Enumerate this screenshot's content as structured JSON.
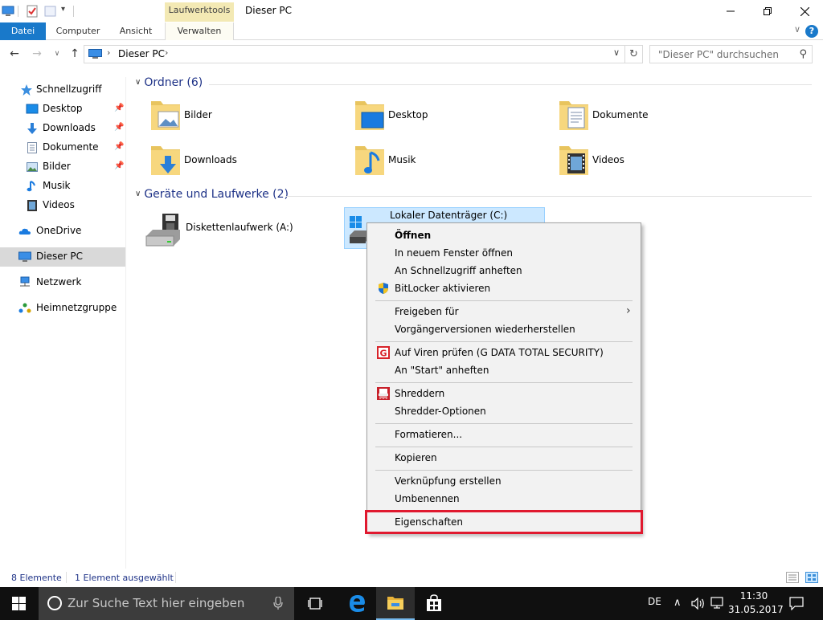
{
  "window": {
    "title": "Dieser PC",
    "contextual_tab_group": "Laufwerktools"
  },
  "ribbon": {
    "tabs": [
      {
        "label": "Datei"
      },
      {
        "label": "Computer"
      },
      {
        "label": "Ansicht"
      },
      {
        "label": "Verwalten"
      }
    ],
    "help": "?"
  },
  "address": {
    "path": "Dieser PC",
    "search_placeholder": "\"Dieser PC\" durchsuchen"
  },
  "nav": {
    "items": [
      {
        "label": "Schnellzugriff",
        "icon": "star-icon",
        "pinned": false
      },
      {
        "label": "Desktop",
        "icon": "desktop-icon",
        "pinned": true
      },
      {
        "label": "Downloads",
        "icon": "download-icon",
        "pinned": true
      },
      {
        "label": "Dokumente",
        "icon": "document-icon",
        "pinned": true
      },
      {
        "label": "Bilder",
        "icon": "pictures-icon",
        "pinned": true
      },
      {
        "label": "Musik",
        "icon": "music-icon",
        "pinned": false
      },
      {
        "label": "Videos",
        "icon": "video-icon",
        "pinned": false
      },
      {
        "label": "OneDrive",
        "icon": "cloud-icon",
        "pinned": false
      },
      {
        "label": "Dieser PC",
        "icon": "computer-icon",
        "pinned": false,
        "selected": true
      },
      {
        "label": "Netzwerk",
        "icon": "network-icon",
        "pinned": false
      },
      {
        "label": "Heimnetzgruppe",
        "icon": "homegroup-icon",
        "pinned": false
      }
    ]
  },
  "content": {
    "folders_header": "Ordner (6)",
    "folders": [
      {
        "label": "Bilder",
        "icon": "pictures-folder-icon"
      },
      {
        "label": "Desktop",
        "icon": "desktop-folder-icon"
      },
      {
        "label": "Dokumente",
        "icon": "documents-folder-icon"
      },
      {
        "label": "Downloads",
        "icon": "downloads-folder-icon"
      },
      {
        "label": "Musik",
        "icon": "music-folder-icon"
      },
      {
        "label": "Videos",
        "icon": "videos-folder-icon"
      }
    ],
    "devices_header": "Geräte und Laufwerke (2)",
    "devices": [
      {
        "label": "Diskettenlaufwerk (A:)",
        "icon": "floppy-drive-icon"
      },
      {
        "label": "Lokaler Datenträger (C:)",
        "icon": "system-drive-icon",
        "selected": true
      }
    ]
  },
  "context_menu": {
    "groups": [
      [
        {
          "label": "Öffnen",
          "bold": true
        },
        {
          "label": "In neuem Fenster öffnen"
        },
        {
          "label": "An Schnellzugriff anheften"
        },
        {
          "label": "BitLocker aktivieren",
          "icon": "uac-shield-icon"
        }
      ],
      [
        {
          "label": "Freigeben für",
          "submenu": true
        },
        {
          "label": "Vorgängerversionen wiederherstellen"
        }
      ],
      [
        {
          "label": "Auf Viren prüfen (G DATA TOTAL SECURITY)",
          "icon": "gdata-icon"
        },
        {
          "label": "An \"Start\" anheften"
        }
      ],
      [
        {
          "label": "Shreddern",
          "icon": "shredder-icon"
        },
        {
          "label": "Shredder-Optionen"
        }
      ],
      [
        {
          "label": "Formatieren..."
        }
      ],
      [
        {
          "label": "Kopieren"
        }
      ],
      [
        {
          "label": "Verknüpfung erstellen"
        },
        {
          "label": "Umbenennen"
        }
      ],
      [
        {
          "label": "Eigenschaften",
          "highlighted": true
        }
      ]
    ],
    "highlight_color": "#e0192f"
  },
  "status": {
    "count": "8 Elemente",
    "selection": "1 Element ausgewählt"
  },
  "taskbar": {
    "search_placeholder": "Zur Suche Text hier eingeben",
    "language": "DE",
    "time": "11:30",
    "date": "31.05.2017"
  },
  "colors": {
    "accent": "#1979ca",
    "header_text": "#1e3287",
    "selection_bg": "#cce8ff",
    "contextual_tab": "#f3e9b4"
  }
}
